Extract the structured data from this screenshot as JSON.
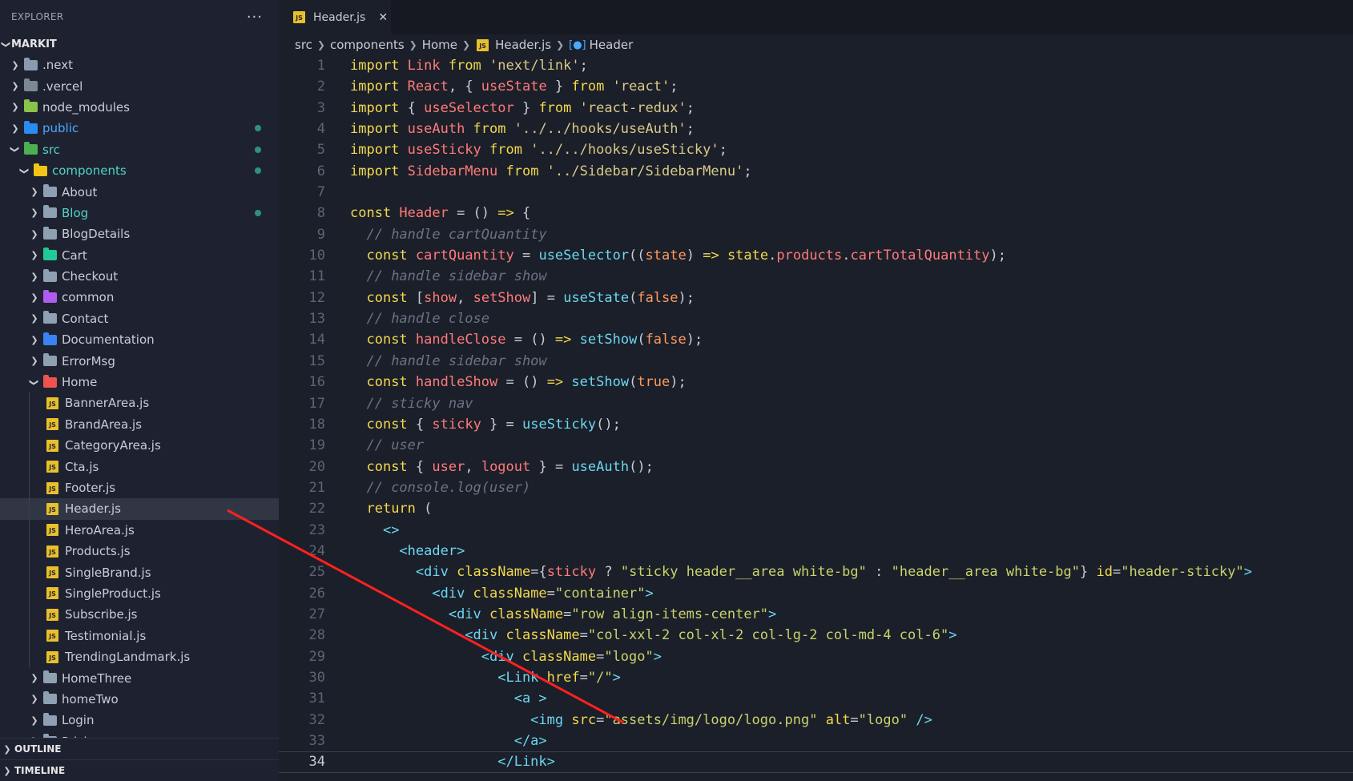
{
  "explorer": {
    "title": "EXPLORER",
    "more": "···",
    "project": "MARKIT"
  },
  "tree": [
    {
      "name": "root-next",
      "label": ".next",
      "depth": 0,
      "chev": "right",
      "icon": "folder",
      "color": "#8a9bb0",
      "lbl": "muted"
    },
    {
      "name": "root-vercel",
      "label": ".vercel",
      "depth": 0,
      "chev": "right",
      "icon": "folder",
      "color": "#7b8794",
      "lbl": "muted"
    },
    {
      "name": "root-node-modules",
      "label": "node_modules",
      "depth": 0,
      "chev": "right",
      "icon": "folder",
      "color": "#8bc34a",
      "lbl": "muted"
    },
    {
      "name": "root-public",
      "label": "public",
      "depth": 0,
      "chev": "right",
      "icon": "folder",
      "color": "#2a8cf0",
      "lbl": "blue",
      "dot": true
    },
    {
      "name": "root-src",
      "label": "src",
      "depth": 0,
      "chev": "down",
      "icon": "folder",
      "color": "#4caf50",
      "lbl": "green",
      "dot": true
    },
    {
      "name": "dir-components",
      "label": "components",
      "depth": 1,
      "chev": "down",
      "icon": "folder",
      "color": "#f0c419",
      "lbl": "green",
      "dot": true
    },
    {
      "name": "dir-about",
      "label": "About",
      "depth": 2,
      "chev": "right",
      "icon": "folder",
      "color": "#8fa0b3",
      "lbl": "muted"
    },
    {
      "name": "dir-blog",
      "label": "Blog",
      "depth": 2,
      "chev": "right",
      "icon": "folder",
      "color": "#8fa0b3",
      "lbl": "green",
      "dot": true
    },
    {
      "name": "dir-blogdetails",
      "label": "BlogDetails",
      "depth": 2,
      "chev": "right",
      "icon": "folder",
      "color": "#8fa0b3",
      "lbl": "muted"
    },
    {
      "name": "dir-cart",
      "label": "Cart",
      "depth": 2,
      "chev": "right",
      "icon": "folder",
      "color": "#20c997",
      "lbl": "muted"
    },
    {
      "name": "dir-checkout",
      "label": "Checkout",
      "depth": 2,
      "chev": "right",
      "icon": "folder",
      "color": "#8fa0b3",
      "lbl": "muted"
    },
    {
      "name": "dir-common",
      "label": "common",
      "depth": 2,
      "chev": "right",
      "icon": "folder",
      "color": "#b05cf0",
      "lbl": "muted"
    },
    {
      "name": "dir-contact",
      "label": "Contact",
      "depth": 2,
      "chev": "right",
      "icon": "folder",
      "color": "#8fa0b3",
      "lbl": "muted"
    },
    {
      "name": "dir-documentation",
      "label": "Documentation",
      "depth": 2,
      "chev": "right",
      "icon": "folder",
      "color": "#3b82f6",
      "lbl": "muted"
    },
    {
      "name": "dir-errormsg",
      "label": "ErrorMsg",
      "depth": 2,
      "chev": "right",
      "icon": "folder",
      "color": "#8fa0b3",
      "lbl": "muted"
    },
    {
      "name": "dir-home",
      "label": "Home",
      "depth": 2,
      "chev": "down",
      "icon": "folder",
      "color": "#ef5350",
      "lbl": "muted"
    },
    {
      "name": "file-bannerarea",
      "label": "BannerArea.js",
      "depth": 3,
      "chev": "none",
      "icon": "js",
      "lbl": "muted"
    },
    {
      "name": "file-brandarea",
      "label": "BrandArea.js",
      "depth": 3,
      "chev": "none",
      "icon": "js",
      "lbl": "muted"
    },
    {
      "name": "file-categoryarea",
      "label": "CategoryArea.js",
      "depth": 3,
      "chev": "none",
      "icon": "js",
      "lbl": "muted"
    },
    {
      "name": "file-cta",
      "label": "Cta.js",
      "depth": 3,
      "chev": "none",
      "icon": "js",
      "lbl": "muted"
    },
    {
      "name": "file-footer",
      "label": "Footer.js",
      "depth": 3,
      "chev": "none",
      "icon": "js",
      "lbl": "muted"
    },
    {
      "name": "file-header",
      "label": "Header.js",
      "depth": 3,
      "chev": "none",
      "icon": "js",
      "lbl": "muted",
      "selected": true
    },
    {
      "name": "file-heroarea",
      "label": "HeroArea.js",
      "depth": 3,
      "chev": "none",
      "icon": "js",
      "lbl": "muted"
    },
    {
      "name": "file-products",
      "label": "Products.js",
      "depth": 3,
      "chev": "none",
      "icon": "js",
      "lbl": "muted"
    },
    {
      "name": "file-singlebrand",
      "label": "SingleBrand.js",
      "depth": 3,
      "chev": "none",
      "icon": "js",
      "lbl": "muted"
    },
    {
      "name": "file-singleproduct",
      "label": "SingleProduct.js",
      "depth": 3,
      "chev": "none",
      "icon": "js",
      "lbl": "muted"
    },
    {
      "name": "file-subscribe",
      "label": "Subscribe.js",
      "depth": 3,
      "chev": "none",
      "icon": "js",
      "lbl": "muted"
    },
    {
      "name": "file-testimonial",
      "label": "Testimonial.js",
      "depth": 3,
      "chev": "none",
      "icon": "js",
      "lbl": "muted"
    },
    {
      "name": "file-trendinglandmark",
      "label": "TrendingLandmark.js",
      "depth": 3,
      "chev": "none",
      "icon": "js",
      "lbl": "muted"
    },
    {
      "name": "dir-homethree",
      "label": "HomeThree",
      "depth": 2,
      "chev": "right",
      "icon": "folder",
      "color": "#8fa0b3",
      "lbl": "muted"
    },
    {
      "name": "dir-hometwo",
      "label": "homeTwo",
      "depth": 2,
      "chev": "right",
      "icon": "folder",
      "color": "#8fa0b3",
      "lbl": "muted"
    },
    {
      "name": "dir-login",
      "label": "Login",
      "depth": 2,
      "chev": "right",
      "icon": "folder",
      "color": "#8fa0b3",
      "lbl": "muted"
    },
    {
      "name": "dir-pricing",
      "label": "Pricing",
      "depth": 2,
      "chev": "right",
      "icon": "folder",
      "color": "#8fa0b3",
      "lbl": "muted"
    }
  ],
  "panels": {
    "outline": "OUTLINE",
    "timeline": "TIMELINE"
  },
  "tab": {
    "label": "Header.js",
    "close": "✕",
    "icon": "JS"
  },
  "breadcrumb": {
    "parts": [
      "src",
      "components",
      "Home",
      "Header.js",
      "Header"
    ]
  },
  "editor": {
    "current_line": 34,
    "lines": [
      [
        [
          "k",
          "import "
        ],
        [
          "v",
          "Link "
        ],
        [
          "k",
          "from "
        ],
        [
          "s",
          "'next/link'"
        ],
        [
          "p",
          ";"
        ]
      ],
      [
        [
          "k",
          "import "
        ],
        [
          "v",
          "React"
        ],
        [
          "p",
          ", { "
        ],
        [
          "v",
          "useState"
        ],
        [
          "p",
          " } "
        ],
        [
          "k",
          "from "
        ],
        [
          "s",
          "'react'"
        ],
        [
          "p",
          ";"
        ]
      ],
      [
        [
          "k",
          "import "
        ],
        [
          "p",
          "{ "
        ],
        [
          "v",
          "useSelector"
        ],
        [
          "p",
          " } "
        ],
        [
          "k",
          "from "
        ],
        [
          "s",
          "'react-redux'"
        ],
        [
          "p",
          ";"
        ]
      ],
      [
        [
          "k",
          "import "
        ],
        [
          "v",
          "useAuth "
        ],
        [
          "k",
          "from "
        ],
        [
          "s",
          "'../../hooks/useAuth'"
        ],
        [
          "p",
          ";"
        ]
      ],
      [
        [
          "k",
          "import "
        ],
        [
          "v",
          "useSticky "
        ],
        [
          "k",
          "from "
        ],
        [
          "s",
          "'../../hooks/useSticky'"
        ],
        [
          "p",
          ";"
        ]
      ],
      [
        [
          "k",
          "import "
        ],
        [
          "v",
          "SidebarMenu "
        ],
        [
          "k",
          "from "
        ],
        [
          "s",
          "'../Sidebar/SidebarMenu'"
        ],
        [
          "p",
          ";"
        ]
      ],
      [],
      [
        [
          "k",
          "const "
        ],
        [
          "v",
          "Header"
        ],
        [
          "p",
          " = () "
        ],
        [
          "k",
          "=>"
        ],
        [
          "p",
          " {"
        ]
      ],
      [
        [
          "p",
          "  "
        ],
        [
          "c",
          "// handle cartQuantity"
        ]
      ],
      [
        [
          "p",
          "  "
        ],
        [
          "k",
          "const "
        ],
        [
          "v",
          "cartQuantity"
        ],
        [
          "p",
          " = "
        ],
        [
          "f",
          "useSelector"
        ],
        [
          "p",
          "(("
        ],
        [
          "o",
          "state"
        ],
        [
          "p",
          ") "
        ],
        [
          "k",
          "=>"
        ],
        [
          "p",
          " "
        ],
        [
          "k",
          "state"
        ],
        [
          "p",
          "."
        ],
        [
          "v",
          "products"
        ],
        [
          "p",
          "."
        ],
        [
          "v",
          "cartTotalQuantity"
        ],
        [
          "p",
          ");"
        ]
      ],
      [
        [
          "p",
          "  "
        ],
        [
          "c",
          "// handle sidebar show"
        ]
      ],
      [
        [
          "p",
          "  "
        ],
        [
          "k",
          "const "
        ],
        [
          "p",
          "["
        ],
        [
          "v",
          "show"
        ],
        [
          "p",
          ", "
        ],
        [
          "v",
          "setShow"
        ],
        [
          "p",
          "] = "
        ],
        [
          "f",
          "useState"
        ],
        [
          "p",
          "("
        ],
        [
          "o",
          "false"
        ],
        [
          "p",
          ");"
        ]
      ],
      [
        [
          "p",
          "  "
        ],
        [
          "c",
          "// handle close"
        ]
      ],
      [
        [
          "p",
          "  "
        ],
        [
          "k",
          "const "
        ],
        [
          "v",
          "handleClose"
        ],
        [
          "p",
          " = () "
        ],
        [
          "k",
          "=>"
        ],
        [
          "p",
          " "
        ],
        [
          "f",
          "setShow"
        ],
        [
          "p",
          "("
        ],
        [
          "o",
          "false"
        ],
        [
          "p",
          ");"
        ]
      ],
      [
        [
          "p",
          "  "
        ],
        [
          "c",
          "// handle sidebar show"
        ]
      ],
      [
        [
          "p",
          "  "
        ],
        [
          "k",
          "const "
        ],
        [
          "v",
          "handleShow"
        ],
        [
          "p",
          " = () "
        ],
        [
          "k",
          "=>"
        ],
        [
          "p",
          " "
        ],
        [
          "f",
          "setShow"
        ],
        [
          "p",
          "("
        ],
        [
          "o",
          "true"
        ],
        [
          "p",
          ");"
        ]
      ],
      [
        [
          "p",
          "  "
        ],
        [
          "c",
          "// sticky nav"
        ]
      ],
      [
        [
          "p",
          "  "
        ],
        [
          "k",
          "const "
        ],
        [
          "p",
          "{ "
        ],
        [
          "v",
          "sticky"
        ],
        [
          "p",
          " } = "
        ],
        [
          "f",
          "useSticky"
        ],
        [
          "p",
          "();"
        ]
      ],
      [
        [
          "p",
          "  "
        ],
        [
          "c",
          "// user"
        ]
      ],
      [
        [
          "p",
          "  "
        ],
        [
          "k",
          "const "
        ],
        [
          "p",
          "{ "
        ],
        [
          "v",
          "user"
        ],
        [
          "p",
          ", "
        ],
        [
          "v",
          "logout"
        ],
        [
          "p",
          " } = "
        ],
        [
          "f",
          "useAuth"
        ],
        [
          "p",
          "();"
        ]
      ],
      [
        [
          "p",
          "  "
        ],
        [
          "c",
          "// console.log(user)"
        ]
      ],
      [
        [
          "p",
          "  "
        ],
        [
          "k",
          "return"
        ],
        [
          "p",
          " ("
        ]
      ],
      [
        [
          "p",
          "    "
        ],
        [
          "t",
          "<>"
        ]
      ],
      [
        [
          "p",
          "      "
        ],
        [
          "t",
          "<header>"
        ]
      ],
      [
        [
          "p",
          "        "
        ],
        [
          "t",
          "<div "
        ],
        [
          "a",
          "className"
        ],
        [
          "p",
          "={"
        ],
        [
          "v",
          "sticky"
        ],
        [
          "p",
          " ? "
        ],
        [
          "s2",
          "\"sticky header__area white-bg\""
        ],
        [
          "p",
          " : "
        ],
        [
          "s2",
          "\"header__area white-bg\""
        ],
        [
          "p",
          "} "
        ],
        [
          "a",
          "id"
        ],
        [
          "p",
          "="
        ],
        [
          "s2",
          "\"header-sticky\""
        ],
        [
          "t",
          ">"
        ]
      ],
      [
        [
          "p",
          "          "
        ],
        [
          "t",
          "<div "
        ],
        [
          "a",
          "className"
        ],
        [
          "p",
          "="
        ],
        [
          "s2",
          "\"container\""
        ],
        [
          "t",
          ">"
        ]
      ],
      [
        [
          "p",
          "            "
        ],
        [
          "t",
          "<div "
        ],
        [
          "a",
          "className"
        ],
        [
          "p",
          "="
        ],
        [
          "s2",
          "\"row align-items-center\""
        ],
        [
          "t",
          ">"
        ]
      ],
      [
        [
          "p",
          "              "
        ],
        [
          "t",
          "<div "
        ],
        [
          "a",
          "className"
        ],
        [
          "p",
          "="
        ],
        [
          "s2",
          "\"col-xxl-2 col-xl-2 col-lg-2 col-md-4 col-6\""
        ],
        [
          "t",
          ">"
        ]
      ],
      [
        [
          "p",
          "                "
        ],
        [
          "t",
          "<div "
        ],
        [
          "a",
          "className"
        ],
        [
          "p",
          "="
        ],
        [
          "s2",
          "\"logo\""
        ],
        [
          "t",
          ">"
        ]
      ],
      [
        [
          "p",
          "                  "
        ],
        [
          "t",
          "<Link "
        ],
        [
          "a",
          "href"
        ],
        [
          "p",
          "="
        ],
        [
          "s2",
          "\"/\""
        ],
        [
          "t",
          ">"
        ]
      ],
      [
        [
          "p",
          "                    "
        ],
        [
          "t",
          "<a >"
        ]
      ],
      [
        [
          "p",
          "                      "
        ],
        [
          "t",
          "<img "
        ],
        [
          "a",
          "src"
        ],
        [
          "p",
          "="
        ],
        [
          "s2",
          "\"assets/img/logo/logo.png\""
        ],
        [
          "p",
          " "
        ],
        [
          "a",
          "alt"
        ],
        [
          "p",
          "="
        ],
        [
          "s2",
          "\"logo\""
        ],
        [
          "p",
          " "
        ],
        [
          "t",
          "/>"
        ]
      ],
      [
        [
          "p",
          "                    "
        ],
        [
          "t",
          "</a>"
        ]
      ],
      [
        [
          "p",
          "                  "
        ],
        [
          "t",
          "</Link>"
        ]
      ]
    ]
  },
  "annotation": {
    "color": "#ff2020"
  }
}
